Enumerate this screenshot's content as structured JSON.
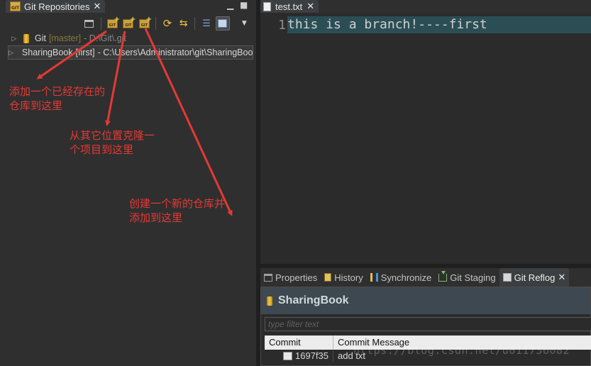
{
  "left_panel": {
    "tab_title": "Git Repositories",
    "repositories": [
      {
        "name": "Git",
        "branch": "[master]",
        "path": "- D:\\Git\\.git"
      },
      {
        "name": "SharingBook",
        "branch": "[first]",
        "path": "- C:\\Users\\Administrator\\git\\SharingBook\\.git"
      }
    ]
  },
  "annotations": {
    "add_existing": "添加一个已经存在的仓库到这里",
    "clone": "从其它位置克隆一个项目到这里",
    "create_new": "创建一个新的仓库并添加到这里"
  },
  "editor": {
    "tab_title": "test.txt",
    "line_number": "1",
    "line_text": "this is a branch!----first"
  },
  "bottom_panel": {
    "tabs": [
      "Properties",
      "History",
      "Synchronize",
      "Git Staging",
      "Git Reflog"
    ],
    "reflog_title": "SharingBook",
    "filter_placeholder": "type filter text",
    "columns": [
      "Commit",
      "Commit Message"
    ],
    "rows": [
      {
        "commit": "1697f35",
        "message": "add txt"
      }
    ]
  },
  "watermark": "https://blog.csdn.net/u011736082",
  "colors": {
    "annotation": "#e53935",
    "line_highlight": "#2b4e55"
  }
}
